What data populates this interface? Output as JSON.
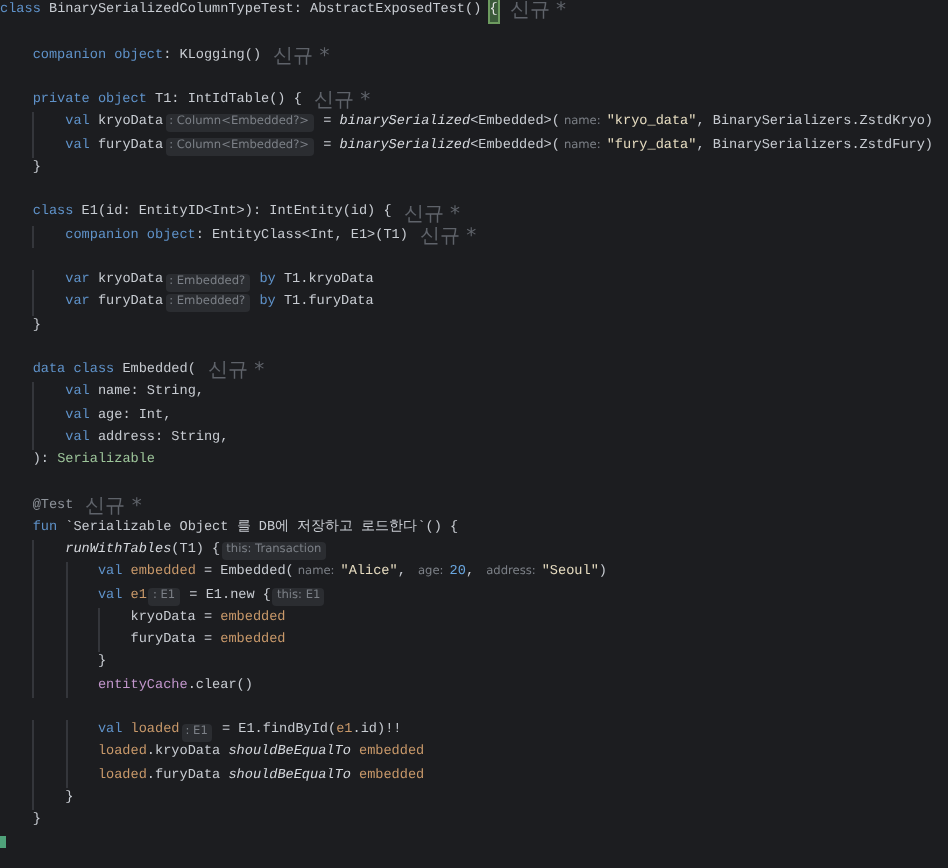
{
  "editor": {
    "lines": [
      {
        "space_above": false,
        "tokens": [
          {
            "kind": "keyword",
            "text": "class"
          },
          {
            "kind": "plain",
            "text": " BinarySerializedColumnTypeTest: AbstractExposedTest() "
          },
          {
            "kind": "brace_match",
            "text": "{"
          },
          {
            "kind": "author",
            "text": "신규 *"
          }
        ]
      },
      {
        "space_above": true,
        "tokens": [
          {
            "kind": "keyword",
            "text": "    companion object"
          },
          {
            "kind": "plain",
            "text": ": KLogging()"
          },
          {
            "kind": "author",
            "text": "신규 *"
          }
        ]
      },
      {
        "space_above": true,
        "tokens": [
          {
            "kind": "keyword",
            "text": "    private object"
          },
          {
            "kind": "plain",
            "text": " T1: IntIdTable() {"
          },
          {
            "kind": "author",
            "text": "신규 *"
          }
        ]
      },
      {
        "space_above": false,
        "tokens": [
          {
            "kind": "keyword",
            "text": "        val"
          },
          {
            "kind": "plain",
            "text": " kryoData"
          },
          {
            "kind": "type_hint",
            "text": ": Column<Embedded?>"
          },
          {
            "kind": "plain",
            "text": " = "
          },
          {
            "kind": "call",
            "text": "binarySerialized"
          },
          {
            "kind": "plain",
            "text": "<Embedded>("
          },
          {
            "kind": "param_hint",
            "text": "name:"
          },
          {
            "kind": "string",
            "text": "\"kryo_data\""
          },
          {
            "kind": "plain",
            "text": ", BinarySerializers.ZstdKryo)"
          }
        ]
      },
      {
        "space_above": false,
        "tokens": [
          {
            "kind": "keyword",
            "text": "        val"
          },
          {
            "kind": "plain",
            "text": " furyData"
          },
          {
            "kind": "type_hint",
            "text": ": Column<Embedded?>"
          },
          {
            "kind": "plain",
            "text": " = "
          },
          {
            "kind": "call",
            "text": "binarySerialized"
          },
          {
            "kind": "plain",
            "text": "<Embedded>("
          },
          {
            "kind": "param_hint",
            "text": "name:"
          },
          {
            "kind": "string",
            "text": "\"fury_data\""
          },
          {
            "kind": "plain",
            "text": ", BinarySerializers.ZstdFury)"
          }
        ]
      },
      {
        "space_above": false,
        "tokens": [
          {
            "kind": "plain",
            "text": "    }"
          }
        ]
      },
      {
        "space_above": true,
        "tokens": [
          {
            "kind": "keyword",
            "text": "    class"
          },
          {
            "kind": "plain",
            "text": " E1(id: EntityID<Int>): IntEntity(id) {"
          },
          {
            "kind": "author",
            "text": "신규 *"
          }
        ]
      },
      {
        "space_above": false,
        "tokens": [
          {
            "kind": "keyword",
            "text": "        companion object"
          },
          {
            "kind": "plain",
            "text": ": EntityClass<Int, E1>(T1)"
          },
          {
            "kind": "author",
            "text": "신규 *"
          }
        ]
      },
      {
        "space_above": true,
        "tokens": [
          {
            "kind": "keyword",
            "text": "        var"
          },
          {
            "kind": "plain",
            "text": " kryoData"
          },
          {
            "kind": "type_hint",
            "text": ": Embedded?"
          },
          {
            "kind": "keyword",
            "text": " by"
          },
          {
            "kind": "plain",
            "text": " T1.kryoData"
          }
        ]
      },
      {
        "space_above": false,
        "tokens": [
          {
            "kind": "keyword",
            "text": "        var"
          },
          {
            "kind": "plain",
            "text": " furyData"
          },
          {
            "kind": "type_hint",
            "text": ": Embedded?"
          },
          {
            "kind": "keyword",
            "text": " by"
          },
          {
            "kind": "plain",
            "text": " T1.furyData"
          }
        ]
      },
      {
        "space_above": false,
        "tokens": [
          {
            "kind": "plain",
            "text": "    }"
          }
        ]
      },
      {
        "space_above": true,
        "tokens": [
          {
            "kind": "keyword",
            "text": "    data class"
          },
          {
            "kind": "plain",
            "text": " Embedded("
          },
          {
            "kind": "author",
            "text": "신규 *"
          }
        ]
      },
      {
        "space_above": false,
        "tokens": [
          {
            "kind": "keyword",
            "text": "        val"
          },
          {
            "kind": "plain",
            "text": " name: String,"
          }
        ]
      },
      {
        "space_above": false,
        "tokens": [
          {
            "kind": "keyword",
            "text": "        val"
          },
          {
            "kind": "plain",
            "text": " age: Int,"
          }
        ]
      },
      {
        "space_above": false,
        "tokens": [
          {
            "kind": "keyword",
            "text": "        val"
          },
          {
            "kind": "plain",
            "text": " address: String,"
          }
        ]
      },
      {
        "space_above": false,
        "tokens": [
          {
            "kind": "plain",
            "text": "    ): "
          },
          {
            "kind": "interface",
            "text": "Serializable"
          }
        ]
      },
      {
        "space_above": true,
        "tokens": [
          {
            "kind": "annotation",
            "text": "    @Test"
          },
          {
            "kind": "author",
            "text": "신규 *"
          }
        ]
      },
      {
        "space_above": false,
        "tokens": [
          {
            "kind": "keyword",
            "text": "    fun"
          },
          {
            "kind": "plain",
            "text": " `Serializable Object 를 DB에 저장하고 로드한다`() {"
          }
        ]
      },
      {
        "space_above": false,
        "tokens": [
          {
            "kind": "call",
            "text": "        runWithTables"
          },
          {
            "kind": "plain",
            "text": "(T1) {"
          },
          {
            "kind": "type_hint",
            "text": "this: Transaction"
          }
        ]
      },
      {
        "space_above": false,
        "tokens": [
          {
            "kind": "keyword",
            "text": "            val"
          },
          {
            "kind": "local",
            "text": " embedded"
          },
          {
            "kind": "plain",
            "text": " = Embedded("
          },
          {
            "kind": "param_hint",
            "text": "name:"
          },
          {
            "kind": "string",
            "text": "\"Alice\""
          },
          {
            "kind": "plain",
            "text": ", "
          },
          {
            "kind": "param_hint",
            "text": "age:"
          },
          {
            "kind": "number",
            "text": "20"
          },
          {
            "kind": "plain",
            "text": ", "
          },
          {
            "kind": "param_hint",
            "text": "address:"
          },
          {
            "kind": "string",
            "text": "\"Seoul\""
          },
          {
            "kind": "plain",
            "text": ")"
          }
        ]
      },
      {
        "space_above": false,
        "tokens": [
          {
            "kind": "keyword",
            "text": "            val"
          },
          {
            "kind": "local",
            "text": " e1"
          },
          {
            "kind": "type_hint",
            "text": ": E1"
          },
          {
            "kind": "plain",
            "text": " = E1.new {"
          },
          {
            "kind": "type_hint",
            "text": "this: E1"
          }
        ]
      },
      {
        "space_above": false,
        "tokens": [
          {
            "kind": "plain",
            "text": "                kryoData = "
          },
          {
            "kind": "local",
            "text": "embedded"
          }
        ]
      },
      {
        "space_above": false,
        "tokens": [
          {
            "kind": "plain",
            "text": "                furyData = "
          },
          {
            "kind": "local",
            "text": "embedded"
          }
        ]
      },
      {
        "space_above": false,
        "tokens": [
          {
            "kind": "plain",
            "text": "            }"
          }
        ]
      },
      {
        "space_above": false,
        "tokens": [
          {
            "kind": "member",
            "text": "            entityCache"
          },
          {
            "kind": "plain",
            "text": ".clear()"
          }
        ]
      },
      {
        "space_above": true,
        "tokens": [
          {
            "kind": "keyword",
            "text": "            val"
          },
          {
            "kind": "local",
            "text": " loaded"
          },
          {
            "kind": "type_hint",
            "text": ": E1"
          },
          {
            "kind": "plain",
            "text": " = E1.findById("
          },
          {
            "kind": "local",
            "text": "e1"
          },
          {
            "kind": "plain",
            "text": ".id)!!"
          }
        ]
      },
      {
        "space_above": false,
        "tokens": [
          {
            "kind": "local",
            "text": "            loaded"
          },
          {
            "kind": "plain",
            "text": ".kryoData "
          },
          {
            "kind": "call",
            "text": "shouldBeEqualTo"
          },
          {
            "kind": "local",
            "text": " embedded"
          }
        ]
      },
      {
        "space_above": false,
        "tokens": [
          {
            "kind": "local",
            "text": "            loaded"
          },
          {
            "kind": "plain",
            "text": ".furyData "
          },
          {
            "kind": "call",
            "text": "shouldBeEqualTo"
          },
          {
            "kind": "local",
            "text": " embedded"
          }
        ]
      },
      {
        "space_above": false,
        "tokens": [
          {
            "kind": "plain",
            "text": "        }"
          }
        ]
      },
      {
        "space_above": false,
        "tokens": [
          {
            "kind": "plain",
            "text": "    }"
          }
        ]
      }
    ]
  }
}
